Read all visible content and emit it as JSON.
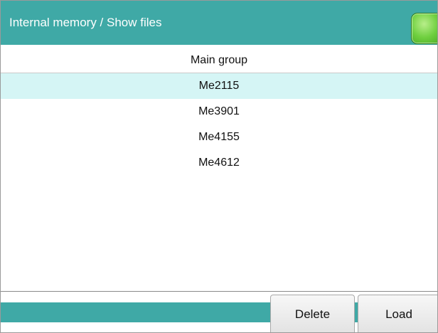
{
  "header": {
    "title": "Internal memory / Show files"
  },
  "list": {
    "column_header": "Main group",
    "items": [
      {
        "label": "Me2115",
        "selected": true
      },
      {
        "label": "Me3901",
        "selected": false
      },
      {
        "label": "Me4155",
        "selected": false
      },
      {
        "label": "Me4612",
        "selected": false
      }
    ]
  },
  "footer": {
    "delete_label": "Delete",
    "load_label": "Load"
  },
  "colors": {
    "accent": "#3fa9a6",
    "selection": "#d5f5f5",
    "status_led": "#6fcf3f"
  }
}
